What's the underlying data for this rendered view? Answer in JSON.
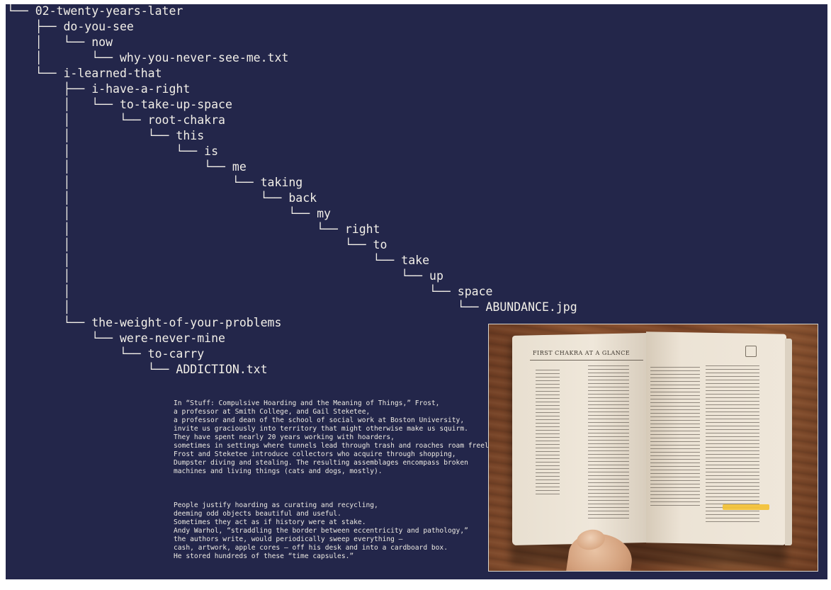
{
  "tree": [
    {
      "text": "└── 02-twenty-years-later"
    },
    {
      "text": "    ├── do-you-see"
    },
    {
      "text": "    │   └── now"
    },
    {
      "text": "    │       └── why-you-never-see-me.txt"
    },
    {
      "text": "    └── i-learned-that"
    },
    {
      "text": "        ├── i-have-a-right"
    },
    {
      "text": "        │   └── to-take-up-space"
    },
    {
      "text": "        │       └── root-chakra"
    },
    {
      "text": "        │           └── this"
    },
    {
      "text": "        │               └── is"
    },
    {
      "text": "        │                   └── me"
    },
    {
      "text": "        │                       └── taking"
    },
    {
      "text": "        │                           └── back"
    },
    {
      "text": "        │                               └── my"
    },
    {
      "text": "        │                                   └── right"
    },
    {
      "text": "        │                                       └── to"
    },
    {
      "text": "        │                                           └── take"
    },
    {
      "text": "        │                                               └── up"
    },
    {
      "text": "        │                                                   └── space"
    },
    {
      "text": "        │                                                       └── ABUNDANCE.jpg"
    },
    {
      "text": "        └── the-weight-of-your-problems"
    },
    {
      "text": "            └── were-never-mine"
    },
    {
      "text": "                └── to-carry"
    },
    {
      "text": "                    └── ADDICTION.txt"
    }
  ],
  "excerpt": {
    "paragraph1": [
      "In “Stuff: Compulsive Hoarding and the Meaning of Things,” Frost,",
      "a professor at Smith College, and Gail Steketee,",
      "a professor and dean of the school of social work at Boston University,",
      "invite us graciously into territory that might otherwise make us squirm.",
      "They have spent nearly 20 years working with hoarders,",
      "sometimes in settings where tunnels lead through trash and roaches roam freely.",
      "Frost and Steketee introduce collectors who acquire through shopping,",
      "Dumpster diving and stealing. The resulting assemblages encompass broken",
      "machines and living things (cats and dogs, mostly)."
    ],
    "paragraph2": [
      "People justify hoarding as curating and recycling,",
      "deeming odd objects beautiful and useful.",
      "Sometimes they act as if history were at stake.",
      "Andy Warhol, “straddling the border between eccentricity and pathology,”",
      "the authors write, would periodically sweep everything –",
      "cash, artwork, apple cores – off his desk and into a cardboard box.",
      "He stored hundreds of these “time capsules.”"
    ]
  },
  "photo": {
    "book_heading": "FIRST CHAKRA AT A GLANCE"
  },
  "colors": {
    "terminal_bg": "#23264a",
    "text": "#f2efe8",
    "highlight": "#f2c23a"
  }
}
